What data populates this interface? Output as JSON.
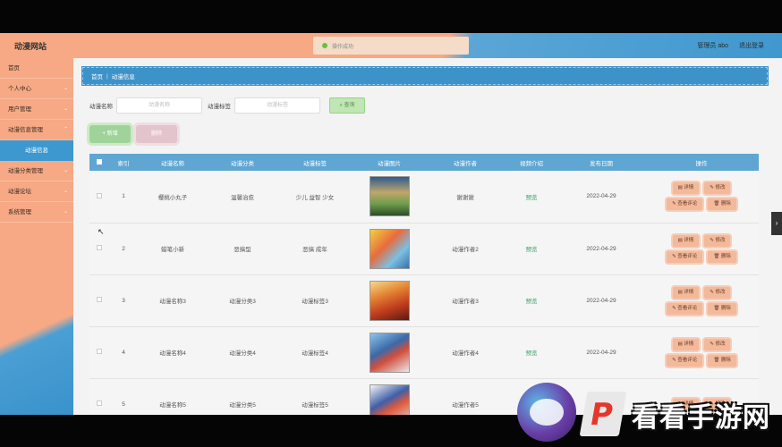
{
  "app": {
    "brand": "动漫网站"
  },
  "toast": {
    "text": "操作成功"
  },
  "header": {
    "user_label": "管理员 abo",
    "logout_label": "退出登录"
  },
  "sidebar": {
    "items": [
      {
        "label": "首页",
        "arrow": ""
      },
      {
        "label": "个人中心",
        "arrow": "⌄"
      },
      {
        "label": "用户管理",
        "arrow": "⌄"
      },
      {
        "label": "动漫信息管理",
        "arrow": "⌃"
      },
      {
        "label": "动漫信息",
        "arrow": ""
      },
      {
        "label": "动漫分类管理",
        "arrow": "⌄"
      },
      {
        "label": "动漫论坛",
        "arrow": "⌄"
      },
      {
        "label": "系统管理",
        "arrow": "⌄"
      }
    ]
  },
  "breadcrumb": {
    "home": "首页",
    "separator": "|",
    "current": "动漫信息"
  },
  "search": {
    "name_label": "动漫名称",
    "name_placeholder": "动漫名称",
    "tag_label": "动漫标签",
    "tag_placeholder": "动漫标签",
    "query_label": "查询"
  },
  "toolbar": {
    "add_label": "+ 新增",
    "delete_label": "删除"
  },
  "table": {
    "headers": [
      "",
      "索引",
      "动漫名称",
      "动漫分类",
      "动漫标签",
      "动漫图片",
      "动漫作者",
      "视频介绍",
      "发布日期",
      "操作"
    ],
    "rows": [
      {
        "index": "1",
        "name": "樱桃小丸子",
        "category": "温馨治愈",
        "tags": "少儿 益智 少女",
        "author": "谢谢谢",
        "video": "预览",
        "date": "2022-04-29"
      },
      {
        "index": "2",
        "name": "蜡笔小新",
        "category": "恶搞型",
        "tags": "恶搞 成年",
        "author": "动漫作者2",
        "video": "预览",
        "date": "2022-04-29"
      },
      {
        "index": "3",
        "name": "动漫名称3",
        "category": "动漫分类3",
        "tags": "动漫标签3",
        "author": "动漫作者3",
        "video": "预览",
        "date": "2022-04-29"
      },
      {
        "index": "4",
        "name": "动漫名称4",
        "category": "动漫分类4",
        "tags": "动漫标签4",
        "author": "动漫作者4",
        "video": "预览",
        "date": "2022-04-29"
      },
      {
        "index": "5",
        "name": "动漫名称5",
        "category": "动漫分类5",
        "tags": "动漫标签5",
        "author": "动漫作者5",
        "video": "预览",
        "date": "2022-04-29"
      }
    ],
    "ops": {
      "detail": "详情",
      "edit": "修改",
      "comments": "查看评论",
      "delete": "删除"
    }
  },
  "watermark": {
    "text": "看看手游网",
    "badge": "P"
  }
}
